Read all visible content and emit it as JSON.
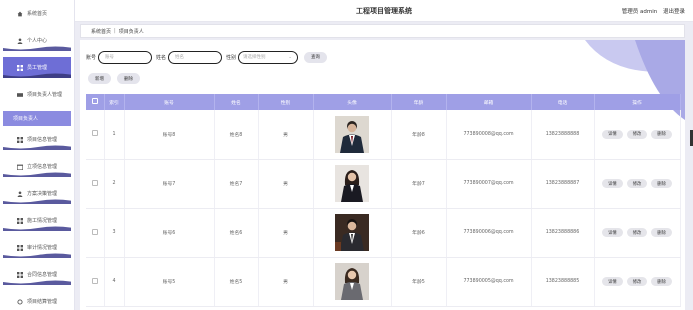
{
  "sidebar": {
    "items": [
      {
        "label": "系统首页",
        "icon": "home-icon"
      },
      {
        "label": "个人中心",
        "icon": "person-icon"
      },
      {
        "label": "员工管理",
        "icon": "grid-icon"
      },
      {
        "label": "项目负责人管理",
        "icon": "card-icon"
      },
      {
        "label": "项目负责人"
      },
      {
        "label": "项目信息管理",
        "icon": "grid-icon"
      },
      {
        "label": "立项信息管理",
        "icon": "calendar-icon"
      },
      {
        "label": "方案决策管理",
        "icon": "person-icon"
      },
      {
        "label": "施工情况管理",
        "icon": "grid-icon"
      },
      {
        "label": "审计情况管理",
        "icon": "grid-icon"
      },
      {
        "label": "合同信息管理",
        "icon": "grid-icon"
      },
      {
        "label": "项目结算管理",
        "icon": "refresh-icon"
      }
    ]
  },
  "header": {
    "title": "工程项目管理系统",
    "user": "管理员 admin",
    "logout": "退出登录"
  },
  "breadcrumb": {
    "home": "系统首页",
    "current": "项目负责人"
  },
  "search": {
    "account_label": "账号",
    "account_placeholder": "账号",
    "name_label": "姓名",
    "name_placeholder": "姓名",
    "gender_label": "性别",
    "gender_placeholder": "请选择性别",
    "query": "查询"
  },
  "actions": {
    "add": "新增",
    "delete": "删除"
  },
  "table": {
    "headers": [
      "索引",
      "账号",
      "姓名",
      "性别",
      "头像",
      "年龄",
      "邮箱",
      "电话",
      "操作"
    ],
    "rows": [
      {
        "index": "1",
        "account": "账号8",
        "name": "姓名8",
        "gender": "男",
        "age": "年龄8",
        "email": "773890008@qq.com",
        "phone": "13823888888",
        "photo": "man"
      },
      {
        "index": "2",
        "account": "账号7",
        "name": "姓名7",
        "gender": "男",
        "age": "年龄7",
        "email": "773890007@qq.com",
        "phone": "13823888887",
        "photo": "woman"
      },
      {
        "index": "3",
        "account": "账号6",
        "name": "姓名6",
        "gender": "男",
        "age": "年龄6",
        "email": "773890006@qq.com",
        "phone": "13823888886",
        "photo": "man"
      },
      {
        "index": "4",
        "account": "账号5",
        "name": "姓名5",
        "gender": "男",
        "age": "年龄5",
        "email": "773890005@qq.com",
        "phone": "13823888885",
        "photo": "woman"
      }
    ],
    "ops": {
      "detail": "详情",
      "edit": "修改",
      "delete": "删除"
    }
  },
  "colors": {
    "accent": "#9f9fe6",
    "active": "#6e6ed6",
    "wave": "#5a5a9e"
  }
}
